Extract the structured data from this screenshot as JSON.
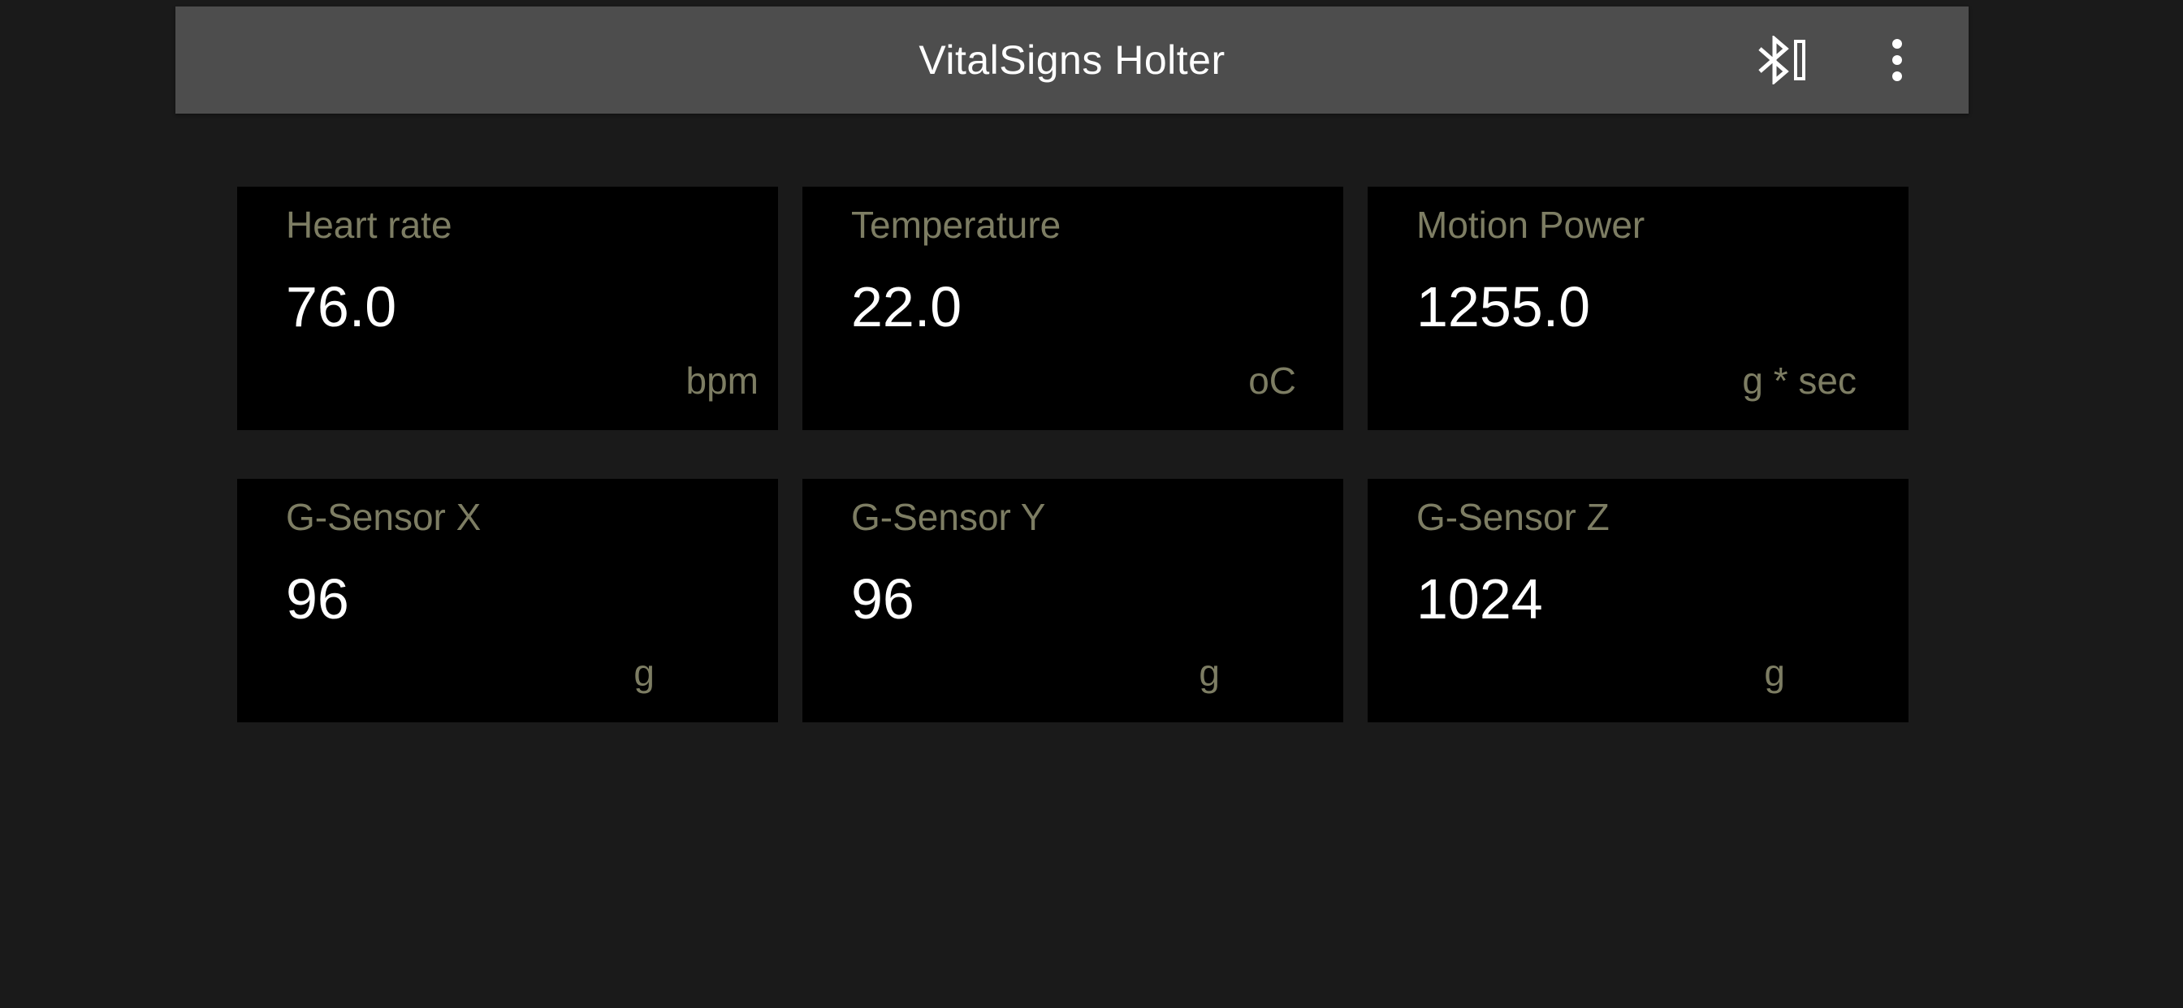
{
  "app_bar": {
    "title": "VitalSigns Holter",
    "bluetooth_icon": "bluetooth-icon",
    "more_icon": "more-vertical-icon"
  },
  "colors": {
    "background": "#1a1a1a",
    "app_bar": "#4d4d4d",
    "tile_background": "#000000",
    "label": "#7d7d63",
    "value": "#ffffff"
  },
  "tiles": [
    {
      "label": "Heart rate",
      "value": "76.0",
      "unit": "bpm"
    },
    {
      "label": "Temperature",
      "value": "22.0",
      "unit": "oC"
    },
    {
      "label": "Motion Power",
      "value": "1255.0",
      "unit": "g * sec"
    },
    {
      "label": "G-Sensor X",
      "value": "96",
      "unit": "g"
    },
    {
      "label": "G-Sensor Y",
      "value": "96",
      "unit": "g"
    },
    {
      "label": "G-Sensor Z",
      "value": "1024",
      "unit": "g"
    }
  ]
}
